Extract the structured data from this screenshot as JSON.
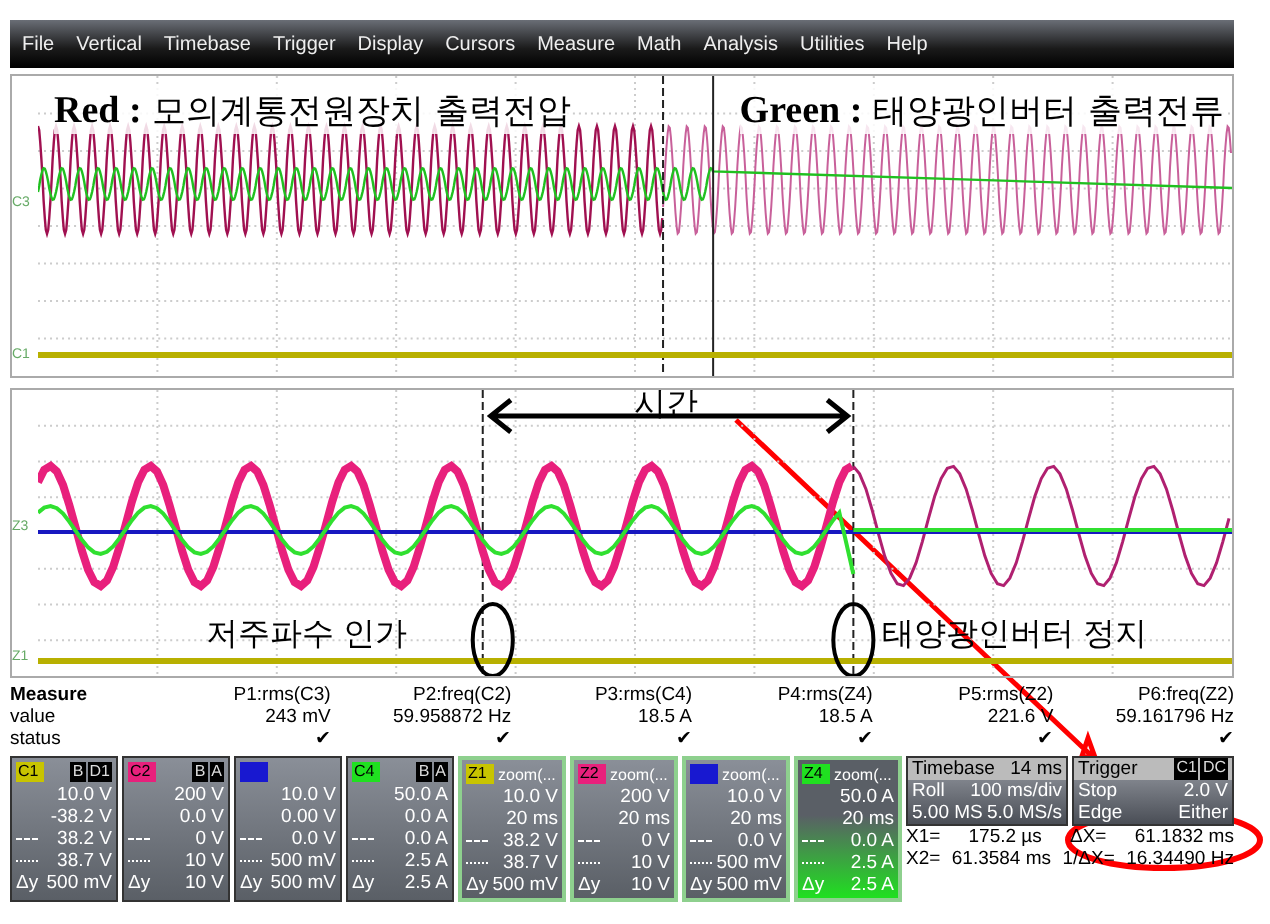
{
  "menu": [
    "File",
    "Vertical",
    "Timebase",
    "Trigger",
    "Display",
    "Cursors",
    "Measure",
    "Math",
    "Analysis",
    "Utilities",
    "Help"
  ],
  "overview": {
    "captions": [
      "**Red :** 모의계통전원장치 출력전압",
      "**Green :** 태양광인버터 출력전류"
    ],
    "trace_labels": [
      "C3",
      "C1"
    ]
  },
  "zoom_view": {
    "time_label": "시간",
    "annotations": [
      "저주파수 인가",
      "태양광인버터 정지"
    ],
    "trace_labels": [
      "Z3",
      "Z1"
    ]
  },
  "measure": {
    "row_labels": [
      "Measure",
      "value",
      "status"
    ],
    "columns": [
      {
        "name": "P1:rms(C3)",
        "value": "243 mV",
        "status": "✔"
      },
      {
        "name": "P2:freq(C2)",
        "value": "59.958872 Hz",
        "status": "✔"
      },
      {
        "name": "P3:rms(C4)",
        "value": "18.5 A",
        "status": "✔"
      },
      {
        "name": "P4:rms(Z4)",
        "value": "18.5 A",
        "status": "✔"
      },
      {
        "name": "P5:rms(Z2)",
        "value": "221.6 V",
        "status": "✔"
      },
      {
        "name": "P6:freq(Z2)",
        "value": "59.161796 Hz",
        "status": "✔"
      }
    ]
  },
  "channels": [
    {
      "kind": "channel",
      "tag": "C1",
      "color": "#c8c400",
      "badges": [
        "B",
        "D1"
      ],
      "scale": "10.0 V",
      "offset": "-38.2 V",
      "line_a": "38.2 V",
      "line_b": "38.7 V",
      "delta_label": "Δy",
      "delta": "500 mV",
      "selected": false
    },
    {
      "kind": "channel",
      "tag": "C2",
      "color": "#e8207c",
      "badges": [
        "B",
        "A"
      ],
      "scale": "200 V",
      "offset": "0.0 V",
      "line_a": "0 V",
      "line_b": "10 V",
      "delta_label": "Δy",
      "delta": "10 V",
      "selected": false
    },
    {
      "kind": "channel",
      "color": "#1818d0",
      "scale": "10.0 V",
      "offset": "0.00 V",
      "line_a": "0.0 V",
      "line_b": "500 mV",
      "delta_label": "Δy",
      "delta": "500 mV",
      "selected": false
    },
    {
      "kind": "channel",
      "tag": "C4",
      "color": "#20e020",
      "badges": [
        "B",
        "A"
      ],
      "scale": "50.0 A",
      "offset": "0.0 A",
      "line_a": "0.0 A",
      "line_b": "2.5 A",
      "delta_label": "Δy",
      "delta": "2.5 A",
      "selected": false
    },
    {
      "kind": "zoom",
      "tag": "Z1",
      "color": "#c8c400",
      "title": "zoom(...",
      "scale": "10.0 V",
      "offset": "20 ms",
      "line_a": "38.2 V",
      "line_b": "38.7 V",
      "delta_label": "Δy",
      "delta": "500 mV",
      "selected": false
    },
    {
      "kind": "zoom",
      "tag": "Z2",
      "color": "#e8207c",
      "title": "zoom(...",
      "scale": "200 V",
      "offset": "20 ms",
      "line_a": "0 V",
      "line_b": "10 V",
      "delta_label": "Δy",
      "delta": "10 V",
      "selected": false
    },
    {
      "kind": "zoom",
      "color": "#1818d0",
      "title": "zoom(...",
      "scale": "10.0 V",
      "offset": "20 ms",
      "line_a": "0.0 V",
      "line_b": "500 mV",
      "delta_label": "Δy",
      "delta": "500 mV",
      "selected": false
    },
    {
      "kind": "zoom",
      "tag": "Z4",
      "color": "#20e020",
      "title": "zoom(...",
      "scale": "50.0 A",
      "offset": "20 ms",
      "line_a": "0.0 A",
      "line_b": "2.5 A",
      "delta_label": "Δy",
      "delta": "2.5 A",
      "selected": true
    }
  ],
  "timebase": {
    "title": "Timebase",
    "value": "14 ms",
    "rows": [
      [
        "Roll",
        "100 ms/div"
      ],
      [
        "5.00 MS",
        "5.0 MS/s"
      ]
    ]
  },
  "trigger": {
    "title": "Trigger",
    "badges": [
      "C1",
      "DC"
    ],
    "rows": [
      [
        "Stop",
        "2.0 V"
      ],
      [
        "Edge",
        "Either"
      ]
    ]
  },
  "cursors": [
    [
      "X1=",
      "175.2 µs",
      "ΔX=",
      "61.1832 ms"
    ],
    [
      "X2=",
      "61.3584 ms",
      "1/ΔX=",
      "16.34490 Hz"
    ]
  ]
}
